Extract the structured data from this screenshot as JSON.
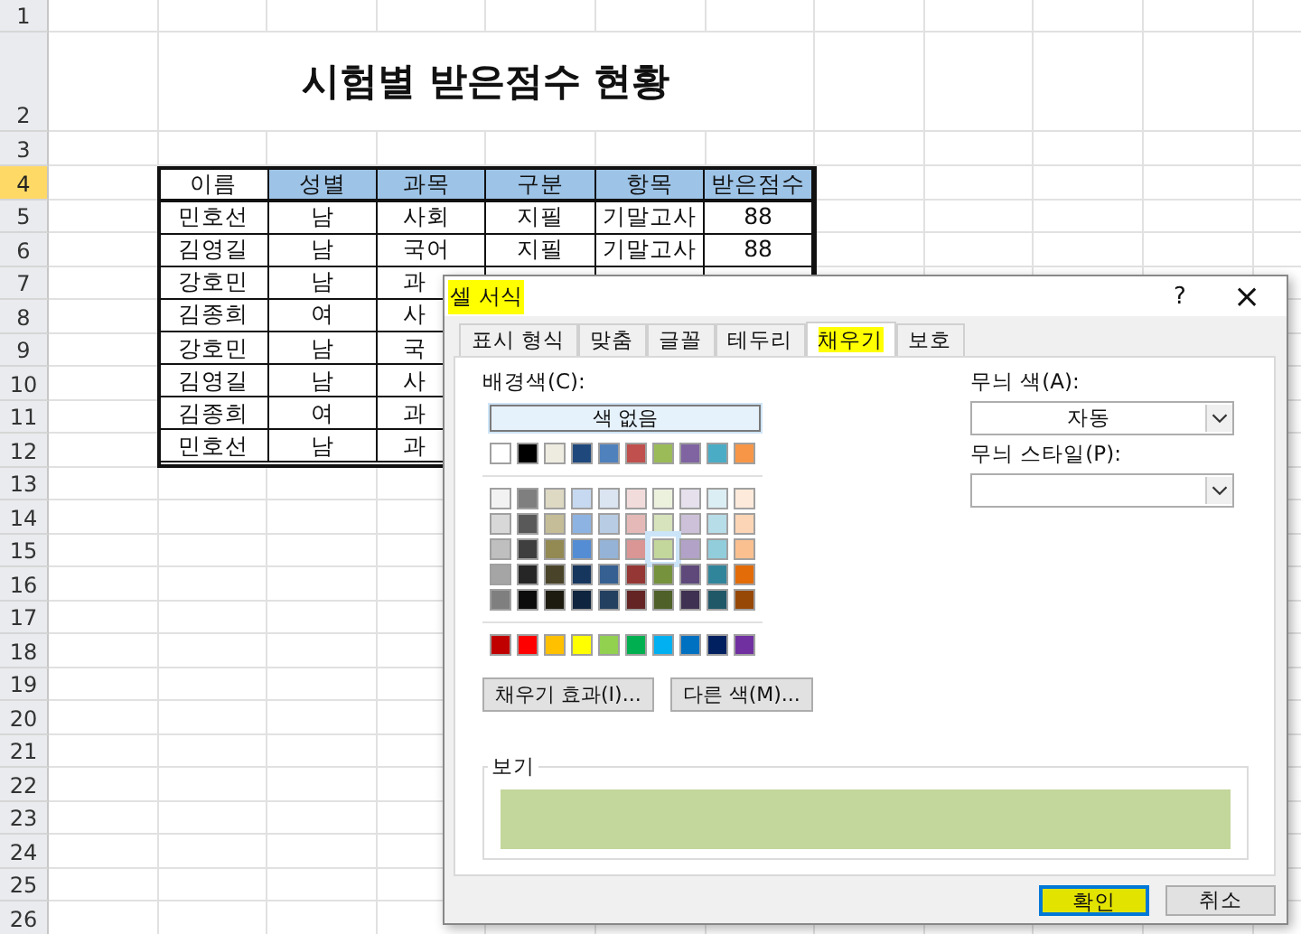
{
  "sheet": {
    "row_headers": [
      {
        "label": "1",
        "selected": false
      },
      {
        "label": "2",
        "selected": false
      },
      {
        "label": "3",
        "selected": false
      },
      {
        "label": "4",
        "selected": true
      },
      {
        "label": "5",
        "selected": false
      },
      {
        "label": "6",
        "selected": false
      },
      {
        "label": "7",
        "selected": false
      },
      {
        "label": "8",
        "selected": false
      },
      {
        "label": "9",
        "selected": false
      },
      {
        "label": "10",
        "selected": false
      },
      {
        "label": "11",
        "selected": false
      },
      {
        "label": "12",
        "selected": false
      },
      {
        "label": "13",
        "selected": false
      },
      {
        "label": "14",
        "selected": false
      },
      {
        "label": "15",
        "selected": false
      },
      {
        "label": "16",
        "selected": false
      },
      {
        "label": "17",
        "selected": false
      },
      {
        "label": "18",
        "selected": false
      },
      {
        "label": "19",
        "selected": false
      },
      {
        "label": "20",
        "selected": false
      },
      {
        "label": "21",
        "selected": false
      },
      {
        "label": "22",
        "selected": false
      },
      {
        "label": "23",
        "selected": false
      },
      {
        "label": "24",
        "selected": false
      },
      {
        "label": "25",
        "selected": false
      },
      {
        "label": "26",
        "selected": false
      }
    ],
    "title": "시험별 받은점수 현황",
    "table": {
      "columns": [
        {
          "label": "이름",
          "highlighted": false
        },
        {
          "label": "성별",
          "highlighted": true
        },
        {
          "label": "과목",
          "highlighted": true
        },
        {
          "label": "구분",
          "highlighted": true
        },
        {
          "label": "항목",
          "highlighted": true
        },
        {
          "label": "받은점수",
          "highlighted": true
        }
      ],
      "rows": [
        [
          "민호선",
          "남",
          "사회",
          "지필",
          "기말고사",
          "88"
        ],
        [
          "김영길",
          "남",
          "국어",
          "지필",
          "기말고사",
          "88"
        ],
        [
          "강호민",
          "남",
          "과"
        ],
        [
          "김종희",
          "여",
          "사"
        ],
        [
          "강호민",
          "남",
          "국"
        ],
        [
          "김영길",
          "남",
          "사"
        ],
        [
          "김종희",
          "여",
          "과"
        ],
        [
          "민호선",
          "남",
          "과"
        ]
      ]
    }
  },
  "dialog": {
    "title": "셀 서식",
    "title_highlighted": true,
    "help": "?",
    "close": "×",
    "tabs": [
      {
        "label": "표시 형식",
        "selected": false,
        "highlighted": false
      },
      {
        "label": "맞춤",
        "selected": false,
        "highlighted": false
      },
      {
        "label": "글꼴",
        "selected": false,
        "highlighted": false
      },
      {
        "label": "테두리",
        "selected": false,
        "highlighted": false
      },
      {
        "label": "채우기",
        "selected": true,
        "highlighted": true
      },
      {
        "label": "보호",
        "selected": false,
        "highlighted": false
      }
    ],
    "background_label": "배경색(C):",
    "no_color_button": "색 없음",
    "palette": [
      [
        {
          "color": "#ffffff",
          "selected": false
        },
        {
          "color": "#000000",
          "selected": false
        },
        {
          "color": "#eeece1",
          "selected": false
        },
        {
          "color": "#1f497d",
          "selected": false
        },
        {
          "color": "#4f81bd",
          "selected": false
        },
        {
          "color": "#c0504d",
          "selected": false
        },
        {
          "color": "#9bbb59",
          "selected": false
        },
        {
          "color": "#8064a2",
          "selected": false
        },
        {
          "color": "#4bacc6",
          "selected": false
        },
        {
          "color": "#f79646",
          "selected": false
        }
      ],
      [
        {
          "color": "#f2f2f2",
          "selected": false
        },
        {
          "color": "#7f7f7f",
          "selected": false
        },
        {
          "color": "#ddd9c3",
          "selected": false
        },
        {
          "color": "#c6d9f0",
          "selected": false
        },
        {
          "color": "#dbe5f1",
          "selected": false
        },
        {
          "color": "#f2dcdb",
          "selected": false
        },
        {
          "color": "#ebf1dd",
          "selected": false
        },
        {
          "color": "#e5e0ec",
          "selected": false
        },
        {
          "color": "#dbeef3",
          "selected": false
        },
        {
          "color": "#fdeada",
          "selected": false
        }
      ],
      [
        {
          "color": "#d8d8d8",
          "selected": false
        },
        {
          "color": "#595959",
          "selected": false
        },
        {
          "color": "#c4bd97",
          "selected": false
        },
        {
          "color": "#8db3e2",
          "selected": false
        },
        {
          "color": "#b8cce4",
          "selected": false
        },
        {
          "color": "#e5b9b7",
          "selected": false
        },
        {
          "color": "#d7e3bc",
          "selected": false
        },
        {
          "color": "#ccc1d9",
          "selected": false
        },
        {
          "color": "#b7dde8",
          "selected": false
        },
        {
          "color": "#fbd5b5",
          "selected": false
        }
      ],
      [
        {
          "color": "#bfbfbf",
          "selected": false
        },
        {
          "color": "#3f3f3f",
          "selected": false
        },
        {
          "color": "#938953",
          "selected": false
        },
        {
          "color": "#548dd4",
          "selected": false
        },
        {
          "color": "#95b3d7",
          "selected": false
        },
        {
          "color": "#d99694",
          "selected": false
        },
        {
          "color": "#c3d69b",
          "selected": true
        },
        {
          "color": "#b2a2c7",
          "selected": false
        },
        {
          "color": "#92cddc",
          "selected": false
        },
        {
          "color": "#fac08f",
          "selected": false
        }
      ],
      [
        {
          "color": "#a5a5a5",
          "selected": false
        },
        {
          "color": "#262626",
          "selected": false
        },
        {
          "color": "#494429",
          "selected": false
        },
        {
          "color": "#17365d",
          "selected": false
        },
        {
          "color": "#366092",
          "selected": false
        },
        {
          "color": "#953734",
          "selected": false
        },
        {
          "color": "#76923c",
          "selected": false
        },
        {
          "color": "#5f497a",
          "selected": false
        },
        {
          "color": "#31859b",
          "selected": false
        },
        {
          "color": "#e36c09",
          "selected": false
        }
      ],
      [
        {
          "color": "#7f7f7f",
          "selected": false
        },
        {
          "color": "#0c0c0c",
          "selected": false
        },
        {
          "color": "#1d1b10",
          "selected": false
        },
        {
          "color": "#0f243e",
          "selected": false
        },
        {
          "color": "#244061",
          "selected": false
        },
        {
          "color": "#632423",
          "selected": false
        },
        {
          "color": "#4f6128",
          "selected": false
        },
        {
          "color": "#3f3151",
          "selected": false
        },
        {
          "color": "#205867",
          "selected": false
        },
        {
          "color": "#974806",
          "selected": false
        }
      ],
      [
        {
          "color": "#c00000",
          "selected": false
        },
        {
          "color": "#ff0000",
          "selected": false
        },
        {
          "color": "#ffc000",
          "selected": false
        },
        {
          "color": "#ffff00",
          "selected": false
        },
        {
          "color": "#92d050",
          "selected": false
        },
        {
          "color": "#00b050",
          "selected": false
        },
        {
          "color": "#00b0f0",
          "selected": false
        },
        {
          "color": "#0070c0",
          "selected": false
        },
        {
          "color": "#002060",
          "selected": false
        },
        {
          "color": "#7030a0",
          "selected": false
        }
      ]
    ],
    "fill_effects_button": "채우기 효과(I)...",
    "more_colors_button": "다른 색(M)...",
    "pattern_color_label": "무늬 색(A):",
    "pattern_color_value": "자동",
    "pattern_style_label": "무늬 스타일(P):",
    "preview_label": "보기",
    "buttons": [
      {
        "label": "확인",
        "highlighted": true
      },
      {
        "label": "취소",
        "highlighted": false
      }
    ]
  }
}
